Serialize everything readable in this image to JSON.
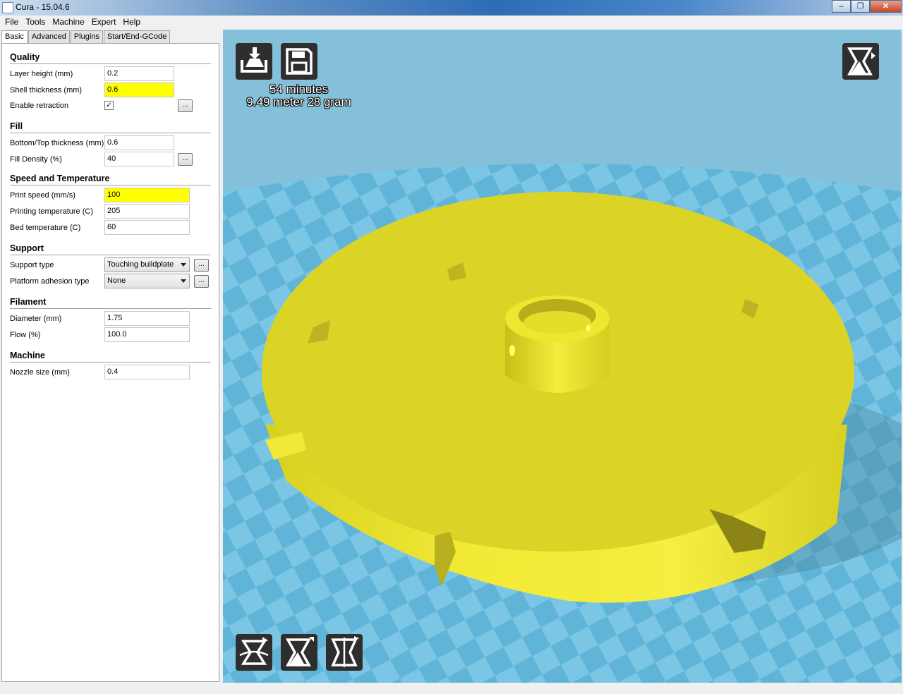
{
  "window": {
    "title": "Cura - 15.04.6"
  },
  "menu": [
    "File",
    "Tools",
    "Machine",
    "Expert",
    "Help"
  ],
  "tabs": [
    "Basic",
    "Advanced",
    "Plugins",
    "Start/End-GCode"
  ],
  "quality": {
    "header": "Quality",
    "layer_height_label": "Layer height (mm)",
    "layer_height": "0.2",
    "shell_thickness_label": "Shell thickness (mm)",
    "shell_thickness": "0.6",
    "retraction_label": "Enable retraction",
    "retraction_checked": true
  },
  "fill": {
    "header": "Fill",
    "bottom_top_label": "Bottom/Top thickness (mm)",
    "bottom_top": "0.6",
    "density_label": "Fill Density (%)",
    "density": "40"
  },
  "speed": {
    "header": "Speed and Temperature",
    "print_speed_label": "Print speed (mm/s)",
    "print_speed": "100",
    "print_temp_label": "Printing temperature (C)",
    "print_temp": "205",
    "bed_temp_label": "Bed temperature (C)",
    "bed_temp": "60"
  },
  "support": {
    "header": "Support",
    "type_label": "Support type",
    "type": "Touching buildplate",
    "adhesion_label": "Platform adhesion type",
    "adhesion": "None"
  },
  "filament": {
    "header": "Filament",
    "diameter_label": "Diameter (mm)",
    "diameter": "1.75",
    "flow_label": "Flow (%)",
    "flow": "100.0"
  },
  "machine": {
    "header": "Machine",
    "nozzle_label": "Nozzle size (mm)",
    "nozzle": "0.4"
  },
  "dots_label": "...",
  "print_info": {
    "time": "54 minutes",
    "material": "9.49 meter 28 gram"
  },
  "icons": {
    "load": "load-model-icon",
    "save": "save-toolpath-icon",
    "view_mode": "view-mode-icon",
    "rotate": "rotate-icon",
    "scale": "scale-icon",
    "mirror": "mirror-icon"
  },
  "colors": {
    "highlight": "#ffff00",
    "model": "#e5e02a",
    "bed": "#84c0da",
    "button": "#2e2e2e"
  }
}
